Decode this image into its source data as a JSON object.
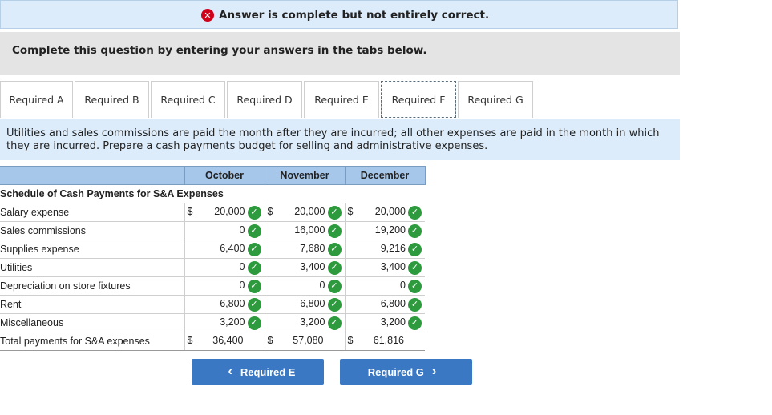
{
  "banner": {
    "icon": "x-circle-icon",
    "text": "Answer is complete but not entirely correct."
  },
  "instruction": "Complete this question by entering your answers in the tabs below.",
  "tabs": [
    {
      "label": "Required A"
    },
    {
      "label": "Required B"
    },
    {
      "label": "Required C"
    },
    {
      "label": "Required D"
    },
    {
      "label": "Required E"
    },
    {
      "label": "Required F"
    },
    {
      "label": "Required G"
    }
  ],
  "active_tab": "Required F",
  "question": "Utilities and sales commissions are paid the month after they are incurred; all other expenses are paid in the month in which they are incurred. Prepare a cash payments budget for selling and administrative expenses.",
  "table": {
    "columns": [
      "October",
      "November",
      "December"
    ],
    "section_title": "Schedule of Cash Payments for S&A Expenses",
    "rows": [
      {
        "label": "Salary expense",
        "values": [
          "20,000",
          "20,000",
          "20,000"
        ],
        "dollar": true,
        "checked": true
      },
      {
        "label": "Sales commissions",
        "values": [
          "0",
          "16,000",
          "19,200"
        ],
        "dollar": false,
        "checked": true
      },
      {
        "label": "Supplies expense",
        "values": [
          "6,400",
          "7,680",
          "9,216"
        ],
        "dollar": false,
        "checked": true
      },
      {
        "label": "Utilities",
        "values": [
          "0",
          "3,400",
          "3,400"
        ],
        "dollar": false,
        "checked": true
      },
      {
        "label": "Depreciation on store fixtures",
        "values": [
          "0",
          "0",
          "0"
        ],
        "dollar": false,
        "checked": true
      },
      {
        "label": "Rent",
        "values": [
          "6,800",
          "6,800",
          "6,800"
        ],
        "dollar": false,
        "checked": true
      },
      {
        "label": "Miscellaneous",
        "values": [
          "3,200",
          "3,200",
          "3,200"
        ],
        "dollar": false,
        "checked": true
      },
      {
        "label": "Total payments for S&A expenses",
        "values": [
          "36,400",
          "57,080",
          "61,816"
        ],
        "dollar": true,
        "checked": false
      }
    ],
    "currency_symbol": "$"
  },
  "nav": {
    "prev_label": "Required E",
    "next_label": "Required G"
  },
  "colors": {
    "banner_bg": "#dcecfb",
    "header_bg": "#a6c7ea",
    "check_green": "#2e9a3e",
    "error_red": "#d0021b",
    "button_blue": "#3a78c3"
  }
}
